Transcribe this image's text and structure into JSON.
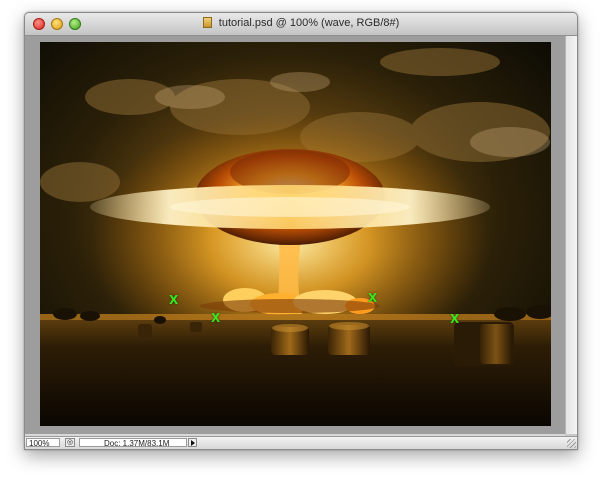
{
  "window": {
    "title": "tutorial.psd @ 100% (wave, RGB/8#)",
    "traffic_lights": [
      "close",
      "minimize",
      "zoom"
    ]
  },
  "canvas": {
    "description_layer": "wave",
    "markers": [
      "X",
      "X",
      "X",
      "X"
    ],
    "marker_color": "#37e61b"
  },
  "statusbar": {
    "zoom": "100%",
    "doc_info": "Doc: 1.37M/83.1M"
  },
  "colors": {
    "window_chrome": "#c8c8c8",
    "canvas_background": "#9d9d9d"
  }
}
